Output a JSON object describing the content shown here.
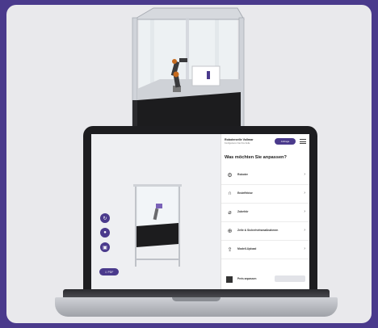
{
  "configurator": {
    "header": {
      "title": "Roboterzelle Vollmar",
      "subtitle": "Konfigurieren Sie Ihre Zelle",
      "cta_label": "Anfrage",
      "menu_icon": "hamburger-icon"
    },
    "question": "Was möchten Sie anpassen?",
    "options": [
      {
        "icon": "robot-arm-icon",
        "glyph": "⚙",
        "label": "Roboter"
      },
      {
        "icon": "gripper-icon",
        "glyph": "∩",
        "label": "Endeffektor"
      },
      {
        "icon": "attachment-icon",
        "glyph": "⌀",
        "label": "Zubehör"
      },
      {
        "icon": "safety-icon",
        "glyph": "⊕",
        "label": "Zelle & Sicherheitsmaßnahmen"
      },
      {
        "icon": "upload-icon",
        "glyph": "⇪",
        "label": "Modell-Upload"
      }
    ],
    "price_label": "Preis anpassen",
    "viewport": {
      "controls": [
        {
          "icon": "rotate-icon",
          "glyph": "↻"
        },
        {
          "icon": "user-icon",
          "glyph": "●"
        },
        {
          "icon": "camera-icon",
          "glyph": "▣"
        }
      ],
      "cta_label": "⇩ PDF"
    }
  },
  "colors": {
    "brand": "#4a3a8c",
    "background": "#e9e9ec",
    "frame": "#c9ccd2",
    "panel": "#1c1c1e"
  }
}
